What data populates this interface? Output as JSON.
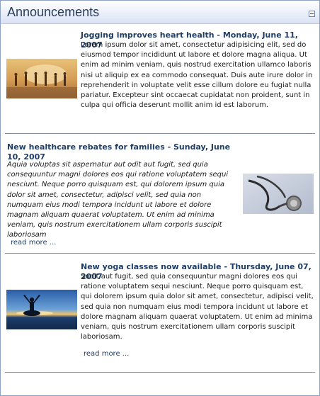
{
  "header": {
    "title": "Announcements",
    "collapse_icon": "collapse-minus-icon"
  },
  "announcements": [
    {
      "title": "Jogging improves heart health - Monday, June 11, 2007",
      "body": "Lorem ipsum dolor sit amet, consectetur adipisicing elit, sed do eiusmod tempor incididunt ut labore et dolore magna aliqua. Ut enim ad minim veniam, quis nostrud exercitation ullamco laboris nisi ut aliquip ex ea commodo consequat. Duis aute irure dolor in reprehenderit in voluptate velit esse cillum dolore eu fugiat nulla pariatur. Excepteur sint occaecat cupidatat non proident, sunt in culpa qui officia deserunt mollit anim id est laborum.",
      "image": "joggers-at-sunset-image"
    },
    {
      "title": "New healthcare rebates for families - Sunday, June 10, 2007",
      "body": "Aquia voluptas sit aspernatur aut odit aut fugit, sed quia consequuntur magni dolores eos qui ratione voluptatem sequi nesciunt. Neque porro quisquam est, qui dolorem ipsum quia dolor sit amet, consectetur, adipisci velit, sed quia non numquam eius modi tempora incidunt ut labore et dolore magnam aliquam quaerat voluptatem. Ut enim ad minima veniam, quis nostrum exercitationem ullam corporis suscipit laboriosam",
      "read_more": "read more ...",
      "image": "stethoscope-image"
    },
    {
      "title": "New yoga classes now available - Thursday, June 07, 2007",
      "body": "Sodit aut fugit, sed quia consequuntur magni dolores eos qui ratione voluptatem sequi nesciunt. Neque porro quisquam est, qui dolorem ipsum quia dolor sit amet, consectetur, adipisci velit, sed quia non numquam eius modi tempora incidunt ut labore et dolore magnam aliquam quaerat voluptatem. Ut enim ad minima veniam, quis nostrum exercitationem ullam corporis suscipit laboriosam.",
      "read_more": "read more ...",
      "image": "yoga-meditation-image"
    }
  ]
}
